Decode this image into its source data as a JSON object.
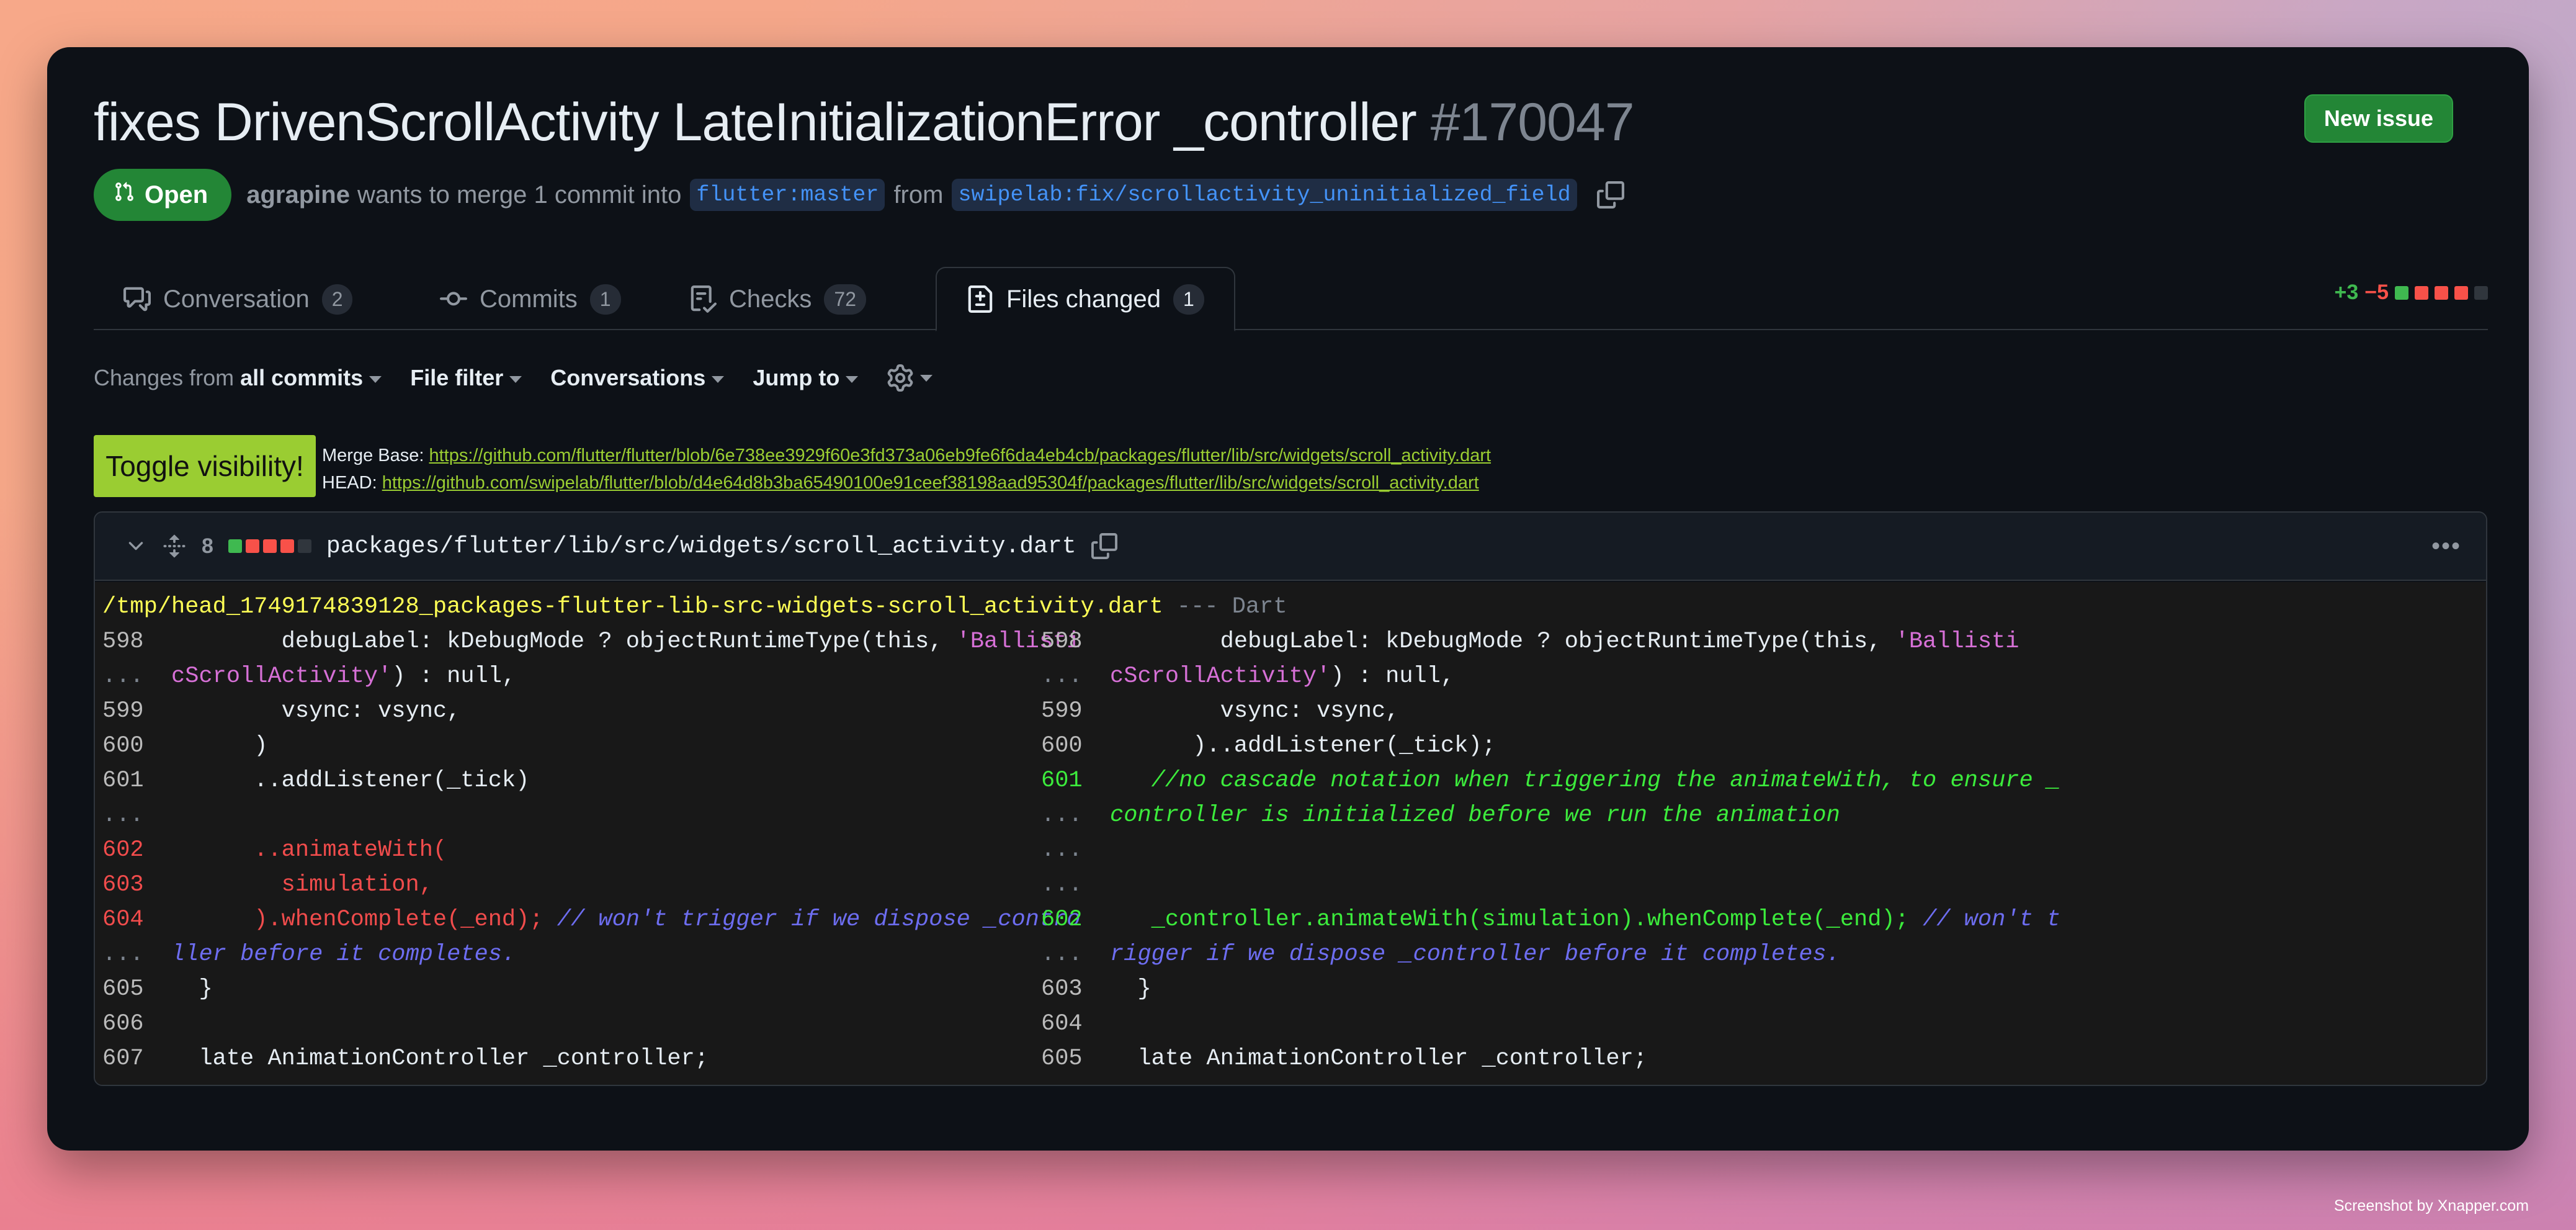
{
  "pr": {
    "title": "fixes DrivenScrollActivity LateInitializationError _controller",
    "number": "#170047",
    "state": "Open",
    "author": "agrapine",
    "merge_text": "wants to merge 1 commit into",
    "base_branch": "flutter:master",
    "from_text": "from",
    "head_branch": "swipelab:fix/scrollactivity_uninitialized_field"
  },
  "new_issue_label": "New issue",
  "tabs": [
    {
      "label": "Conversation",
      "count": "2",
      "icon": "conversation-icon"
    },
    {
      "label": "Commits",
      "count": "1",
      "icon": "commit-icon"
    },
    {
      "label": "Checks",
      "count": "72",
      "icon": "checks-icon"
    },
    {
      "label": "Files changed",
      "count": "1",
      "icon": "file-diff-icon"
    }
  ],
  "diffstat": {
    "additions": "+3",
    "deletions": "−5"
  },
  "toolbar": {
    "changes_prefix": "Changes from",
    "changes_value": "all commits",
    "file_filter": "File filter",
    "conversations": "Conversations",
    "jump_to": "Jump to"
  },
  "toggle_label": "Toggle visibility!",
  "links": {
    "merge_base_label": "Merge Base:",
    "merge_base_url": "https://github.com/flutter/flutter/blob/6e738ee3929f60e3fd373a06eb9fe6f6da4eb4cb/packages/flutter/lib/src/widgets/scroll_activity.dart",
    "head_label": "HEAD:",
    "head_url": "https://github.com/swipelab/flutter/blob/d4e64d8b3ba65490100e91ceef38198aad95304f/packages/flutter/lib/src/widgets/scroll_activity.dart"
  },
  "file": {
    "changes": "8",
    "path": "packages/flutter/lib/src/widgets/scroll_activity.dart",
    "tmp_path": "/tmp/head_1749174839128_packages-flutter-lib-src-widgets-scroll_activity.dart",
    "lang_sep": "--- Dart"
  },
  "colors": {
    "accent_green": "#238636",
    "link_blue": "#4493f8",
    "toggle": "#9acd32"
  },
  "footer": "Screenshot by Xnapper.com"
}
